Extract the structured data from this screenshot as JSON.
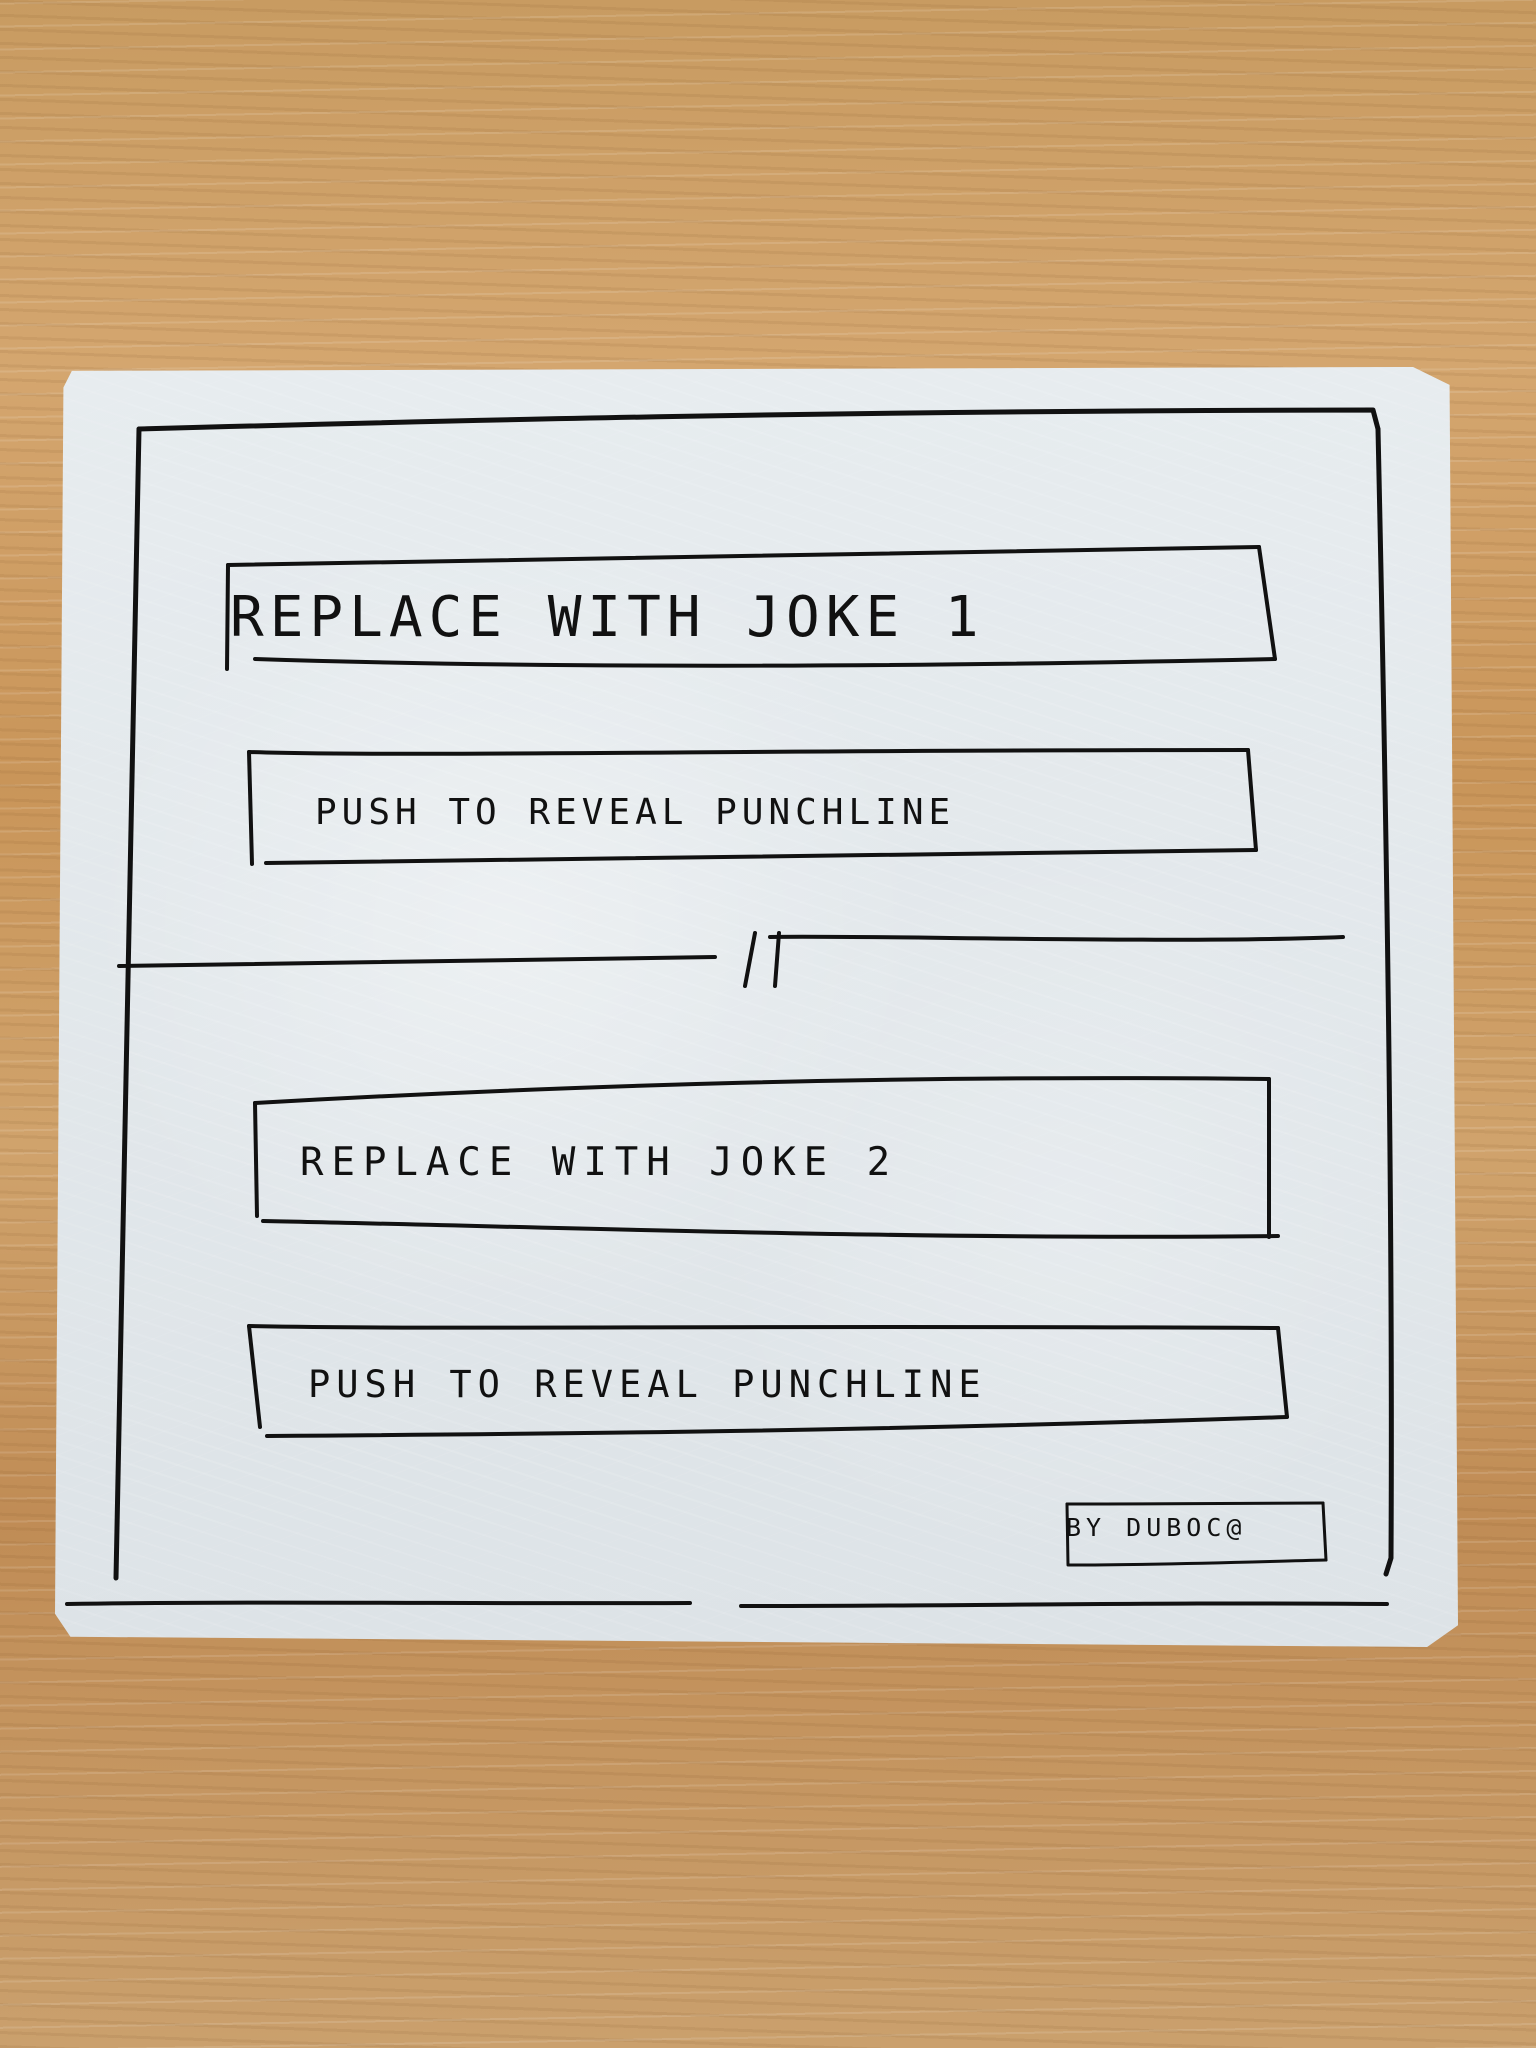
{
  "sketch": {
    "joke_1": "REPLACE WITH JOKE 1",
    "punchline_1": "PUSH TO REVEAL PUNCHLINE",
    "joke_2": "REPLACE WITH JOKE 2",
    "punchline_2": "PUSH TO REVEAL PUNCHLINE",
    "signature": "BY DUBOC@"
  },
  "colors": {
    "ink": "#111111",
    "napkin": "#e4e9ec",
    "table": "#c99a62"
  }
}
